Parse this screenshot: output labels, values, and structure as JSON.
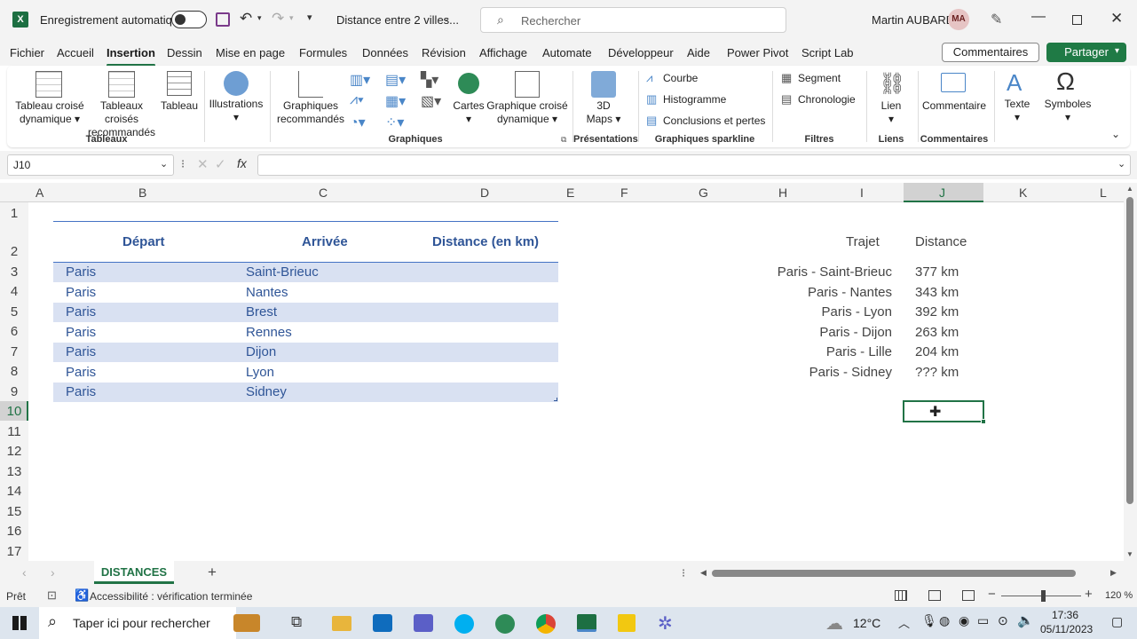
{
  "titlebar": {
    "autosave_label": "Enregistrement automatique",
    "doc_title": "Distance entre 2 villes...",
    "search_placeholder": "Rechercher",
    "user_name": "Martin AUBARD",
    "user_initials": "MA"
  },
  "menu": [
    "Fichier",
    "Accueil",
    "Insertion",
    "Dessin",
    "Mise en page",
    "Formules",
    "Données",
    "Révision",
    "Affichage",
    "Automate",
    "Développeur",
    "Aide",
    "Power Pivot",
    "Script Lab"
  ],
  "menu_active": "Insertion",
  "comments_button": "Commentaires",
  "share_button": "Partager",
  "ribbon": {
    "tableaux": {
      "b1": "Tableau croisé",
      "b1b": "dynamique",
      "b2": "Tableaux croisés",
      "b2b": "recommandés",
      "b3": "Tableau",
      "group": "Tableaux"
    },
    "illustrations": "Illustrations",
    "graphiques": {
      "b1": "Graphiques",
      "b1b": "recommandés",
      "cartes": "Cartes",
      "gcd": "Graphique croisé",
      "gcdb": "dynamique",
      "group": "Graphiques"
    },
    "presentations": {
      "b1": "3D",
      "b1b": "Maps",
      "group": "Présentations"
    },
    "sparkline": {
      "courbe": "Courbe",
      "histo": "Histogramme",
      "concl": "Conclusions et pertes",
      "group": "Graphiques sparkline"
    },
    "filtres": {
      "segment": "Segment",
      "chrono": "Chronologie",
      "group": "Filtres"
    },
    "liens": {
      "lien": "Lien",
      "group": "Liens"
    },
    "commentaires": {
      "b": "Commentaire",
      "group": "Commentaires"
    },
    "texte": "Texte",
    "symboles": "Symboles"
  },
  "namebox": "J10",
  "fx": "fx",
  "columns": [
    "A",
    "B",
    "C",
    "D",
    "E",
    "F",
    "G",
    "H",
    "I",
    "J",
    "K",
    "L"
  ],
  "rows": [
    "1",
    "2",
    "3",
    "4",
    "5",
    "6",
    "7",
    "8",
    "9",
    "10",
    "11",
    "12",
    "13",
    "14",
    "15",
    "16",
    "17"
  ],
  "table": {
    "headers": [
      "Départ",
      "Arrivée",
      "Distance (en km)"
    ],
    "rows": [
      [
        "Paris",
        "Saint-Brieuc"
      ],
      [
        "Paris",
        "Nantes"
      ],
      [
        "Paris",
        "Brest"
      ],
      [
        "Paris",
        "Rennes"
      ],
      [
        "Paris",
        "Dijon"
      ],
      [
        "Paris",
        "Lyon"
      ],
      [
        "Paris",
        "Sidney"
      ]
    ]
  },
  "side": {
    "h1": "Trajet",
    "h2": "Distance",
    "rows": [
      [
        "Paris - Saint-Brieuc",
        "377 km"
      ],
      [
        "Paris - Nantes",
        "343 km"
      ],
      [
        "Paris - Lyon",
        "392 km"
      ],
      [
        "Paris - Dijon",
        "263 km"
      ],
      [
        "Paris - Lille",
        "204 km"
      ],
      [
        "Paris - Sidney",
        "??? km"
      ]
    ]
  },
  "sheet_tab": "DISTANCES",
  "status": {
    "ready": "Prêt",
    "accessibility": "Accessibilité : vérification terminée",
    "zoom": "120 %"
  },
  "taskbar": {
    "search": "Taper ici pour rechercher",
    "temp": "12°C",
    "time": "17:36",
    "date": "05/11/2023"
  },
  "colors": {
    "excel_green": "#217346",
    "table_band": "#d9e1f2",
    "table_text": "#2f5597"
  }
}
